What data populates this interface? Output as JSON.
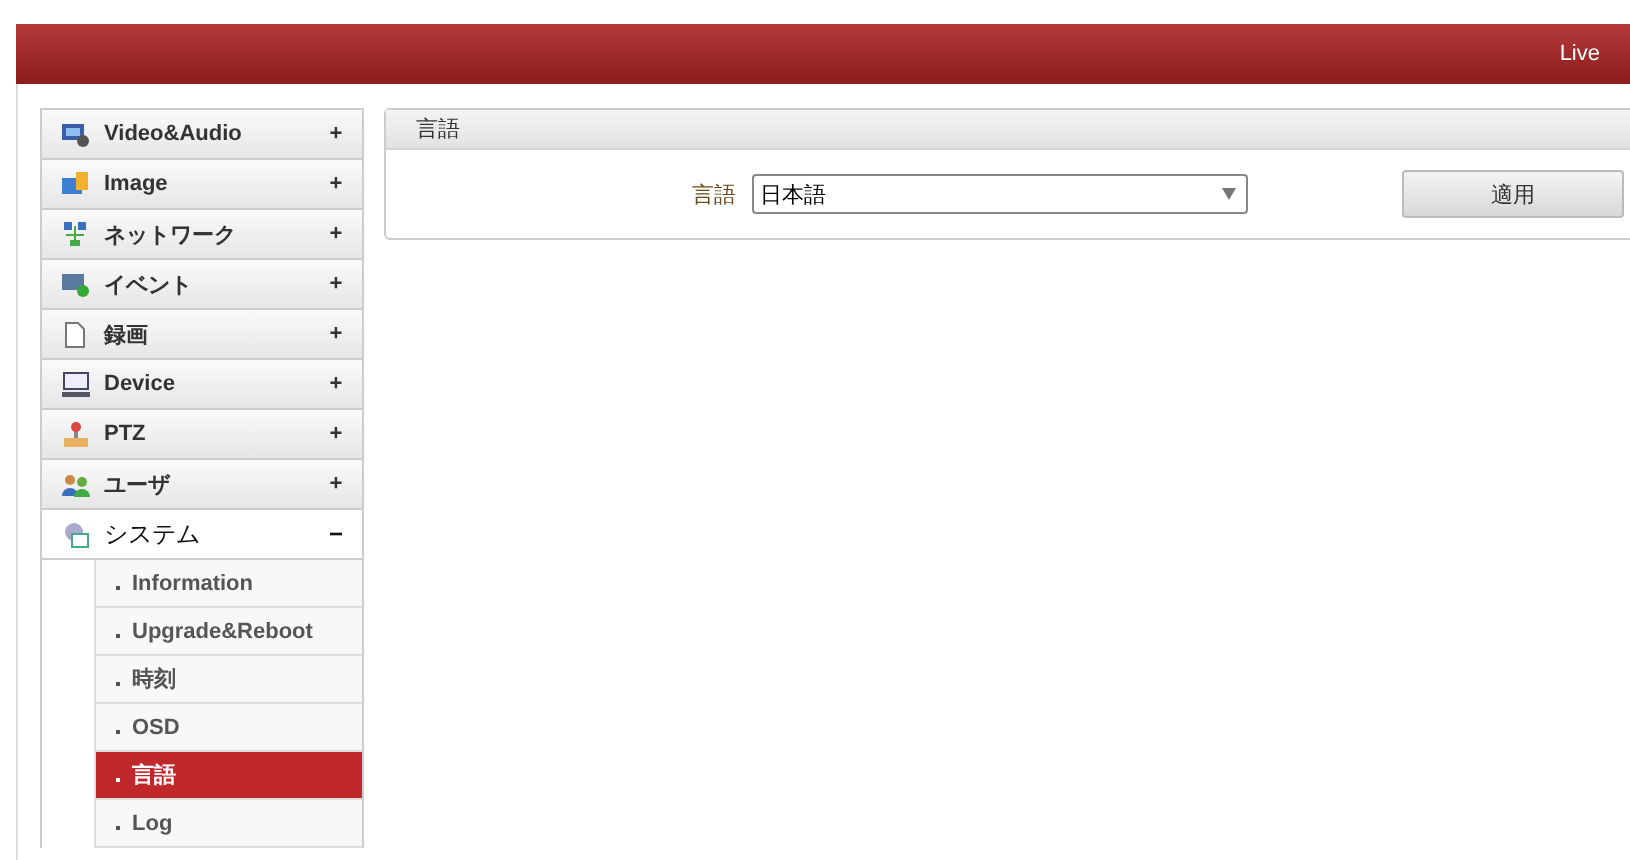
{
  "header": {
    "live_link": "Live"
  },
  "sidebar": {
    "items": [
      {
        "label": "Video&Audio",
        "toggle": "+",
        "expanded": false
      },
      {
        "label": "Image",
        "toggle": "+",
        "expanded": false
      },
      {
        "label": "ネットワーク",
        "toggle": "+",
        "expanded": false
      },
      {
        "label": "イベント",
        "toggle": "+",
        "expanded": false
      },
      {
        "label": "録画",
        "toggle": "+",
        "expanded": false
      },
      {
        "label": "Device",
        "toggle": "+",
        "expanded": false
      },
      {
        "label": "PTZ",
        "toggle": "+",
        "expanded": false
      },
      {
        "label": "ユーザ",
        "toggle": "+",
        "expanded": false
      },
      {
        "label": "システム",
        "toggle": "−",
        "expanded": true,
        "children": [
          {
            "label": "Information",
            "selected": false
          },
          {
            "label": "Upgrade&Reboot",
            "selected": false
          },
          {
            "label": "時刻",
            "selected": false
          },
          {
            "label": "OSD",
            "selected": false
          },
          {
            "label": "言語",
            "selected": true
          },
          {
            "label": "Log",
            "selected": false
          }
        ]
      }
    ]
  },
  "panel": {
    "title": "言語",
    "field_label": "言語",
    "select_value": "日本語",
    "apply_button": "適用"
  }
}
